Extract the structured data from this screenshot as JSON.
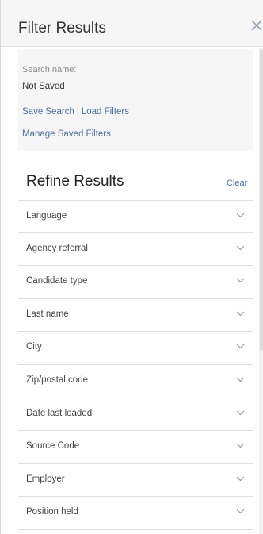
{
  "header": {
    "title": "Filter Results"
  },
  "search": {
    "name_label": "Search name:",
    "name_value": "Not Saved",
    "save_link": "Save Search",
    "separator": "|",
    "load_link": "Load Filters",
    "manage_link": "Manage Saved Filters"
  },
  "refine": {
    "title": "Refine Results",
    "clear": "Clear",
    "filters": [
      {
        "label": "Language"
      },
      {
        "label": "Agency referral"
      },
      {
        "label": "Candidate type"
      },
      {
        "label": "Last name"
      },
      {
        "label": "City"
      },
      {
        "label": "Zip/postal code"
      },
      {
        "label": "Date last loaded"
      },
      {
        "label": "Source Code"
      },
      {
        "label": "Employer"
      },
      {
        "label": "Position held"
      }
    ]
  },
  "colors": {
    "link": "#4a6fa8",
    "header_bg": "#f6f6f6",
    "divider": "#dedede"
  }
}
